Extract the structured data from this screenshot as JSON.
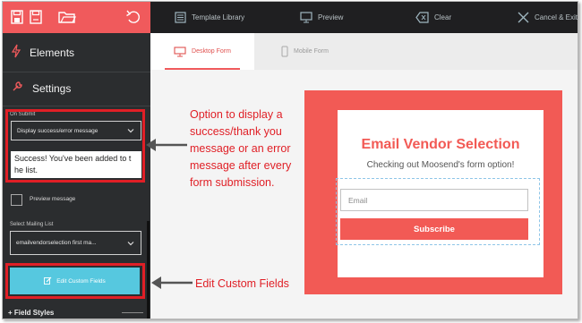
{
  "toolbar": {
    "left_icons": [
      "save-icon",
      "save-as-icon",
      "open-folder-icon",
      "undo-icon"
    ],
    "items": [
      {
        "icon": "template-library-icon",
        "label": "Template Library"
      },
      {
        "icon": "monitor-preview-icon",
        "label": "Preview"
      },
      {
        "icon": "eraser-icon",
        "label": "Clear"
      },
      {
        "icon": "close-icon",
        "label": "Cancel & Exit"
      }
    ]
  },
  "sidebar": {
    "elements_label": "Elements",
    "settings_label": "Settings",
    "on_submit_label": "On Submit",
    "on_submit_value": "Display success/error message",
    "message_text": "Success! You've been added to t he list.",
    "preview_message_label": "Preview message",
    "mailing_list_label": "Select Mailing List",
    "mailing_list_value": "emailvendorselection first ma...",
    "edit_button_label": "Edit Custom Fields",
    "field_styles_label": "+ Field Styles"
  },
  "tabs": {
    "desktop": "Desktop Form",
    "mobile": "Mobile Form"
  },
  "annotations": {
    "submit_note_lines": [
      "Option to display a",
      "success/thank you",
      "message or an error",
      "message after every",
      "form submission."
    ],
    "edit_note": "Edit Custom Fields"
  },
  "form_preview": {
    "title": "Email Vendor Selection",
    "subtitle": "Checking out Moosend's form option!",
    "email_placeholder": "Email",
    "button_label": "Subscribe"
  },
  "colors": {
    "brand_red": "#f05a5c",
    "annotation_red": "#e01f26",
    "sidebar_bg": "#2b2d2f",
    "toolbar_bg": "#1f1f21",
    "button_cyan": "#56c8df"
  }
}
